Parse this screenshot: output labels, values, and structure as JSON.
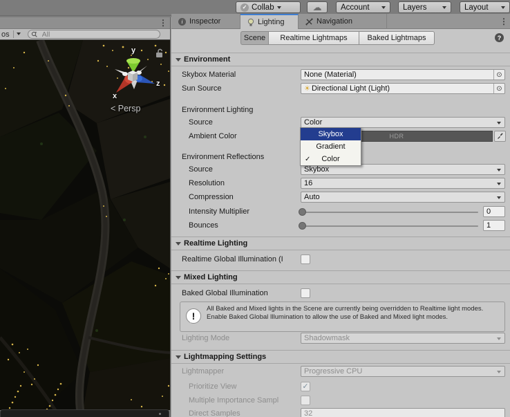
{
  "toolbar": {
    "collab_label": "Collab",
    "account_label": "Account",
    "layers_label": "Layers",
    "layout_label": "Layout"
  },
  "tabs": {
    "inspector": "Inspector",
    "lighting": "Lighting",
    "navigation": "Navigation"
  },
  "subtabs": {
    "scene": "Scene",
    "realtime_lightmaps": "Realtime Lightmaps",
    "baked_lightmaps": "Baked Lightmaps"
  },
  "scene_view": {
    "gizmos_button_partial": "os",
    "search_placeholder": "All",
    "persp_label": "< Persp",
    "axis_x": "x",
    "axis_y": "y",
    "axis_z": "z"
  },
  "environment": {
    "header": "Environment",
    "rows": {
      "skybox_material": {
        "label": "Skybox Material",
        "value": "None (Material)"
      },
      "sun_source": {
        "label": "Sun Source",
        "value": "Directional Light (Light)"
      },
      "lighting_group": "Environment Lighting",
      "source": {
        "label": "Source",
        "value": "Color"
      },
      "ambient_color": {
        "label": "Ambient Color",
        "hdr": "HDR"
      },
      "reflections_group": "Environment Reflections",
      "refl_source": {
        "label": "Source",
        "value": "Skybox"
      },
      "resolution": {
        "label": "Resolution",
        "value": "16"
      },
      "compression": {
        "label": "Compression",
        "value": "Auto"
      },
      "intensity_multiplier": {
        "label": "Intensity Multiplier",
        "value": "0"
      },
      "bounces": {
        "label": "Bounces",
        "value": "1"
      }
    }
  },
  "source_dropdown_menu": {
    "items": [
      {
        "label": "Skybox"
      },
      {
        "label": "Gradient"
      },
      {
        "label": "Color",
        "check": "✓"
      }
    ]
  },
  "realtime_lighting": {
    "header": "Realtime Lighting",
    "global_illumination_label": "Realtime Global Illumination (I"
  },
  "mixed_lighting": {
    "header": "Mixed Lighting",
    "baked_gi_label": "Baked Global Illumination",
    "warning_icon": "!",
    "warning_text": "All Baked and Mixed lights in the Scene are currently being overridden to Realtime light modes. Enable Baked Global Illumination to allow the use of Baked and Mixed light modes.",
    "lighting_mode": {
      "label": "Lighting Mode",
      "value": "Shadowmask"
    }
  },
  "lightmapping_settings": {
    "header": "Lightmapping Settings",
    "lightmapper": {
      "label": "Lightmapper",
      "value": "Progressive CPU"
    },
    "prioritize_view_label": "Prioritize View",
    "multiple_importance_label": "Multiple Importance Sampl",
    "direct_samples": {
      "label": "Direct Samples",
      "value": "32"
    }
  },
  "icons": {
    "help": "?",
    "more": "⋮",
    "check": "✓",
    "cloud": "☁",
    "sun": "☀",
    "object_picker": "⊙",
    "info": "i"
  },
  "colors": {
    "tab_accent_blue": "#3d7dd2",
    "menu_highlight_blue": "#233d8f",
    "axis_y_green": "#7ccb2f",
    "axis_x_red": "#b23527",
    "axis_z_blue": "#2b55b8"
  }
}
